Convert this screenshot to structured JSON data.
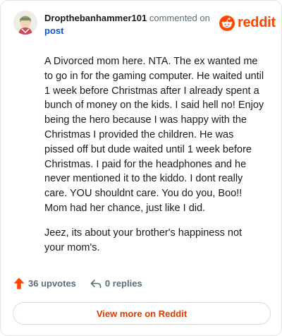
{
  "header": {
    "username": "Dropthebanhammer101",
    "action_text": "commented on",
    "post_link": "post"
  },
  "logo": {
    "wordmark": "reddit",
    "icon": "reddit-snoo-icon"
  },
  "comment": {
    "paragraphs": [
      "A Divorced mom here. NTA. The ex wanted me to go in for the gaming computer. He waited until 1 week before Christmas after I already spent a bunch of money on the kids. I said hell no! Enjoy being the hero because I was happy with the Christmas I provided the children. He was pissed off but dude waited until 1 week before Christmas. I paid for the headphones and he never mentioned it to the kiddo. I dont really care. YOU shouldnt care. You do you, Boo!! Mom had her chance, just like I did.",
      "Jeez, its about your brother's happiness not your mom's."
    ]
  },
  "actions": {
    "upvotes_label": "36 upvotes",
    "replies_label": "0 replies",
    "upvote_icon": "upvote-arrow-icon",
    "reply_icon": "reply-arrow-icon"
  },
  "footer": {
    "view_more_label": "View more on Reddit"
  },
  "colors": {
    "brand": "#ff4500",
    "link": "#0a58c0",
    "muted": "#576f76",
    "cta_text": "#d93a00"
  }
}
